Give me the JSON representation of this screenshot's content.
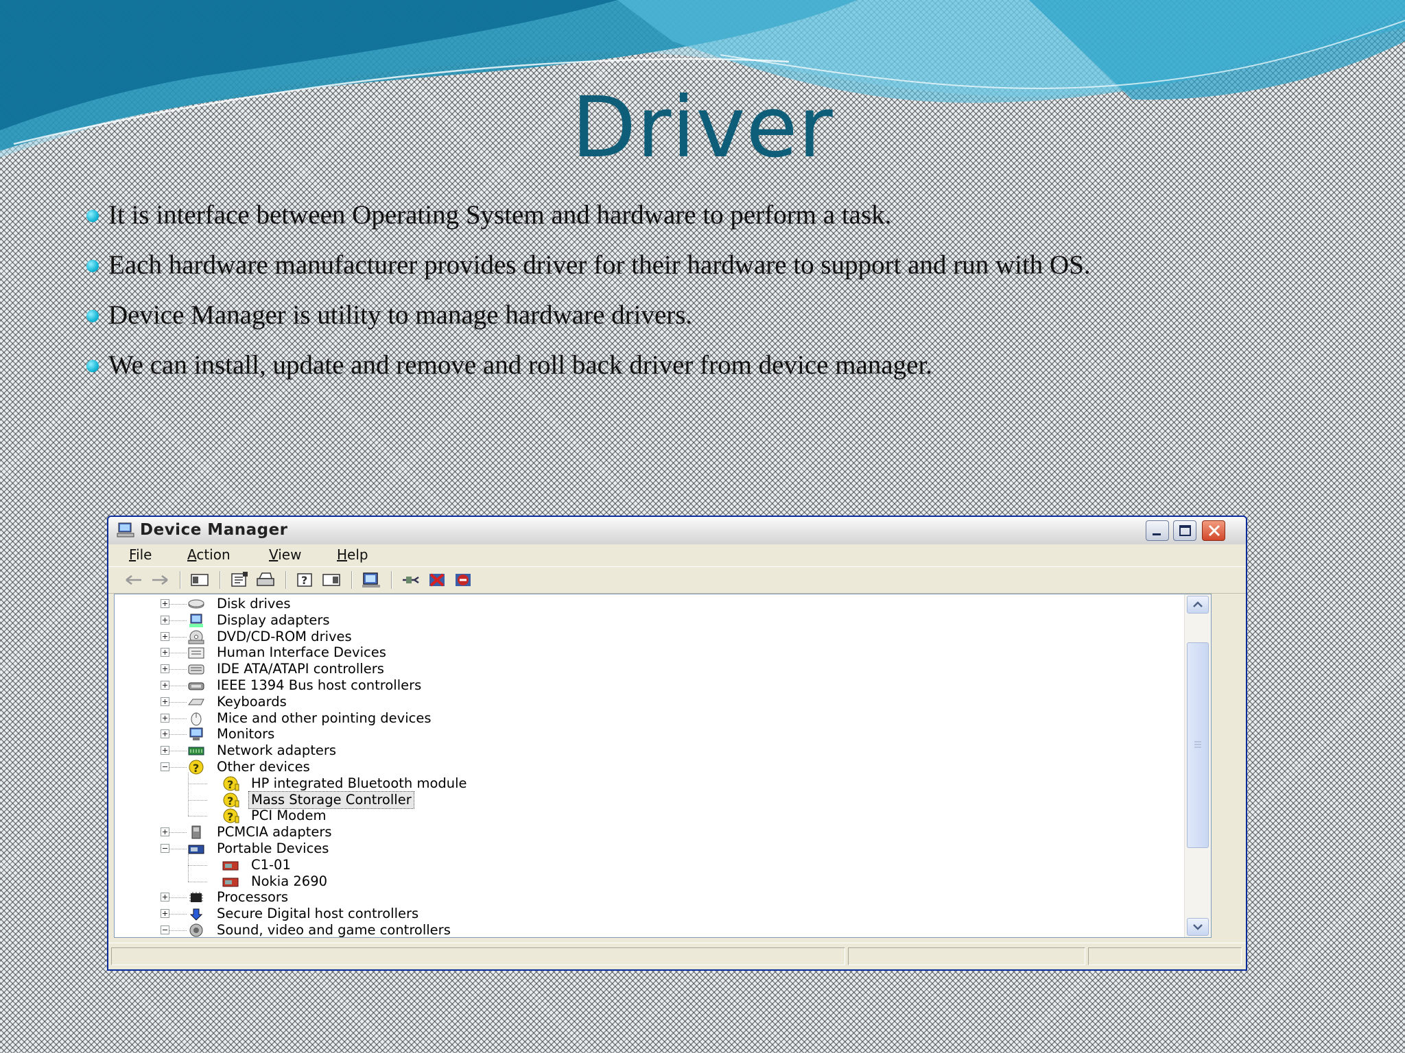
{
  "slide": {
    "title": "Driver",
    "bullets": [
      "It is interface between Operating System and hardware to perform a task.",
      "Each hardware manufacturer provides driver for their hardware to support and run with OS.",
      "Device Manager is utility to manage hardware drivers.",
      "We can install, update and remove and roll back driver from device manager."
    ]
  },
  "window": {
    "title": "Device Manager",
    "menu": {
      "file": {
        "hotkey": "F",
        "rest": "ile"
      },
      "action": {
        "hotkey": "A",
        "rest": "ction"
      },
      "view": {
        "hotkey": "V",
        "rest": "iew"
      },
      "help": {
        "hotkey": "H",
        "rest": "elp"
      }
    },
    "tree": [
      {
        "label": "Disk drives",
        "icon": "disk-drive-icon"
      },
      {
        "label": "Display adapters",
        "icon": "display-adapter-icon"
      },
      {
        "label": "DVD/CD-ROM drives",
        "icon": "cd-drive-icon"
      },
      {
        "label": "Human Interface Devices",
        "icon": "hid-icon"
      },
      {
        "label": "IDE ATA/ATAPI controllers",
        "icon": "ide-controller-icon"
      },
      {
        "label": "IEEE 1394 Bus host controllers",
        "icon": "ieee1394-icon"
      },
      {
        "label": "Keyboards",
        "icon": "keyboard-icon"
      },
      {
        "label": "Mice and other pointing devices",
        "icon": "mouse-icon"
      },
      {
        "label": "Monitors",
        "icon": "monitor-icon"
      },
      {
        "label": "Network adapters",
        "icon": "network-adapter-icon"
      },
      {
        "label": "Other devices",
        "icon": "unknown-device-icon"
      },
      {
        "label": "HP integrated Bluetooth module",
        "icon": "warning-device-icon"
      },
      {
        "label": "Mass Storage Controller",
        "icon": "warning-device-icon"
      },
      {
        "label": "PCI Modem",
        "icon": "warning-device-icon"
      },
      {
        "label": "PCMCIA adapters",
        "icon": "pcmcia-icon"
      },
      {
        "label": "Portable Devices",
        "icon": "portable-devices-icon"
      },
      {
        "label": "C1-01",
        "icon": "phone-icon"
      },
      {
        "label": "Nokia 2690",
        "icon": "phone-icon"
      },
      {
        "label": "Processors",
        "icon": "processor-icon"
      },
      {
        "label": "Secure Digital host controllers",
        "icon": "sd-controller-icon"
      },
      {
        "label": "Sound, video and game controllers",
        "icon": "sound-icon"
      }
    ],
    "selected_item": "Mass Storage Controller",
    "colors": {
      "title": "#0e5e79",
      "bullet": "#17b6d6",
      "warning": "#f2d21b"
    }
  }
}
